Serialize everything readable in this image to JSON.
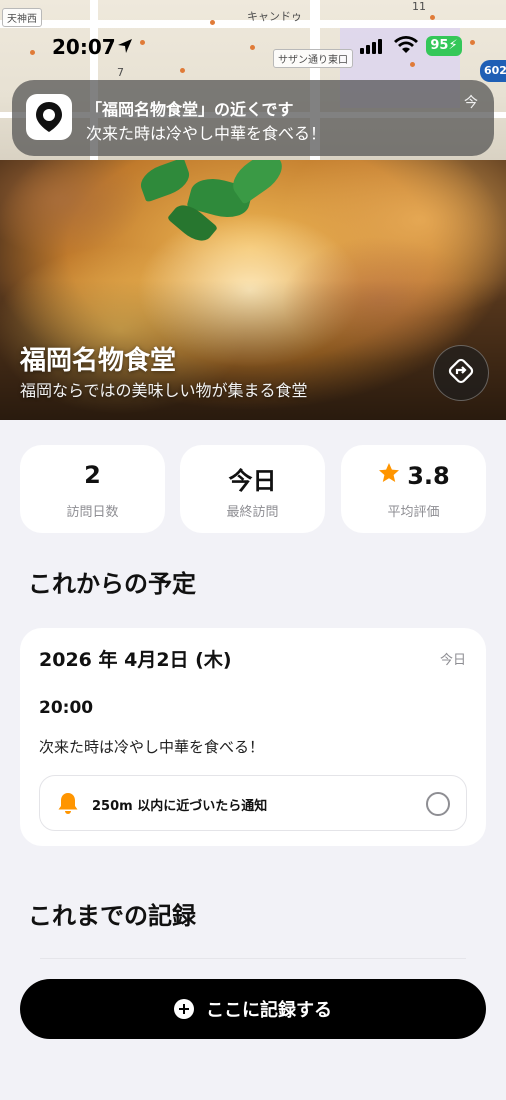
{
  "status_bar": {
    "time": "20:07",
    "battery": "95"
  },
  "map": {
    "labels": [
      "天神西",
      "キャンドゥ",
      "サザン通り東口",
      "11",
      "7",
      "602"
    ]
  },
  "notification": {
    "title": "「福岡名物食堂」の近くです",
    "body": "次来た時は冷やし中華を食べる！",
    "time": "今"
  },
  "place": {
    "name": "福岡名物食堂",
    "description": "福岡ならではの美味しい物が集まる食堂"
  },
  "stats": [
    {
      "value": "2",
      "label": "訪問日数"
    },
    {
      "value": "今日",
      "label": "最終訪問"
    },
    {
      "value": "3.8",
      "label": "平均評価"
    }
  ],
  "colors": {
    "accent": "#ff9500",
    "button": "#000000",
    "background": "#f2f2f7",
    "battery": "#34c759"
  },
  "upcoming": {
    "section_title": "これからの予定",
    "date": "2026 年 4月2日 (木)",
    "relative": "今日",
    "time": "20:00",
    "note": "次来た時は冷やし中華を食べる！",
    "notify_label": "250m 以内に近づいたら通知"
  },
  "history": {
    "section_title": "これまでの記録"
  },
  "actions": {
    "record_label": "ここに記録する"
  }
}
